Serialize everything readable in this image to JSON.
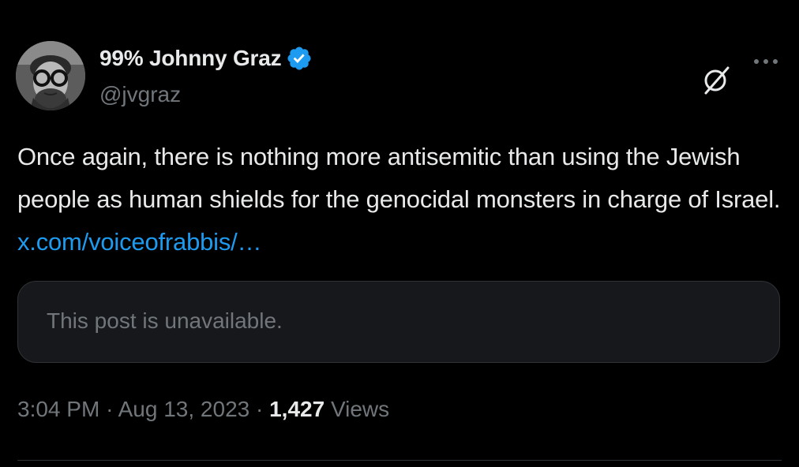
{
  "author": {
    "display_name": "99% Johnny Graz",
    "handle": "@jvgraz",
    "verified": true
  },
  "tweet": {
    "text": "Once again, there is nothing more antisemitic than using the Jewish people as human shields for the genocidal monsters in charge of Israel. ",
    "link_text": "x.com/voiceofrabbis/…"
  },
  "quoted_post": {
    "unavailable_text": "This post is unavailable."
  },
  "meta": {
    "time": "3:04 PM",
    "separator": "·",
    "date": "Aug 13, 2023",
    "views_count": "1,427",
    "views_label": "Views"
  },
  "icons": {
    "verified": "verified-badge-icon",
    "grok": "grok-icon",
    "more": "more-options-icon"
  },
  "colors": {
    "background": "#000000",
    "text_primary": "#e7e9ea",
    "text_secondary": "#71767b",
    "link": "#1d9bf0",
    "verified": "#1d9bf0",
    "card_background": "#16181c",
    "border": "#2f3336"
  }
}
